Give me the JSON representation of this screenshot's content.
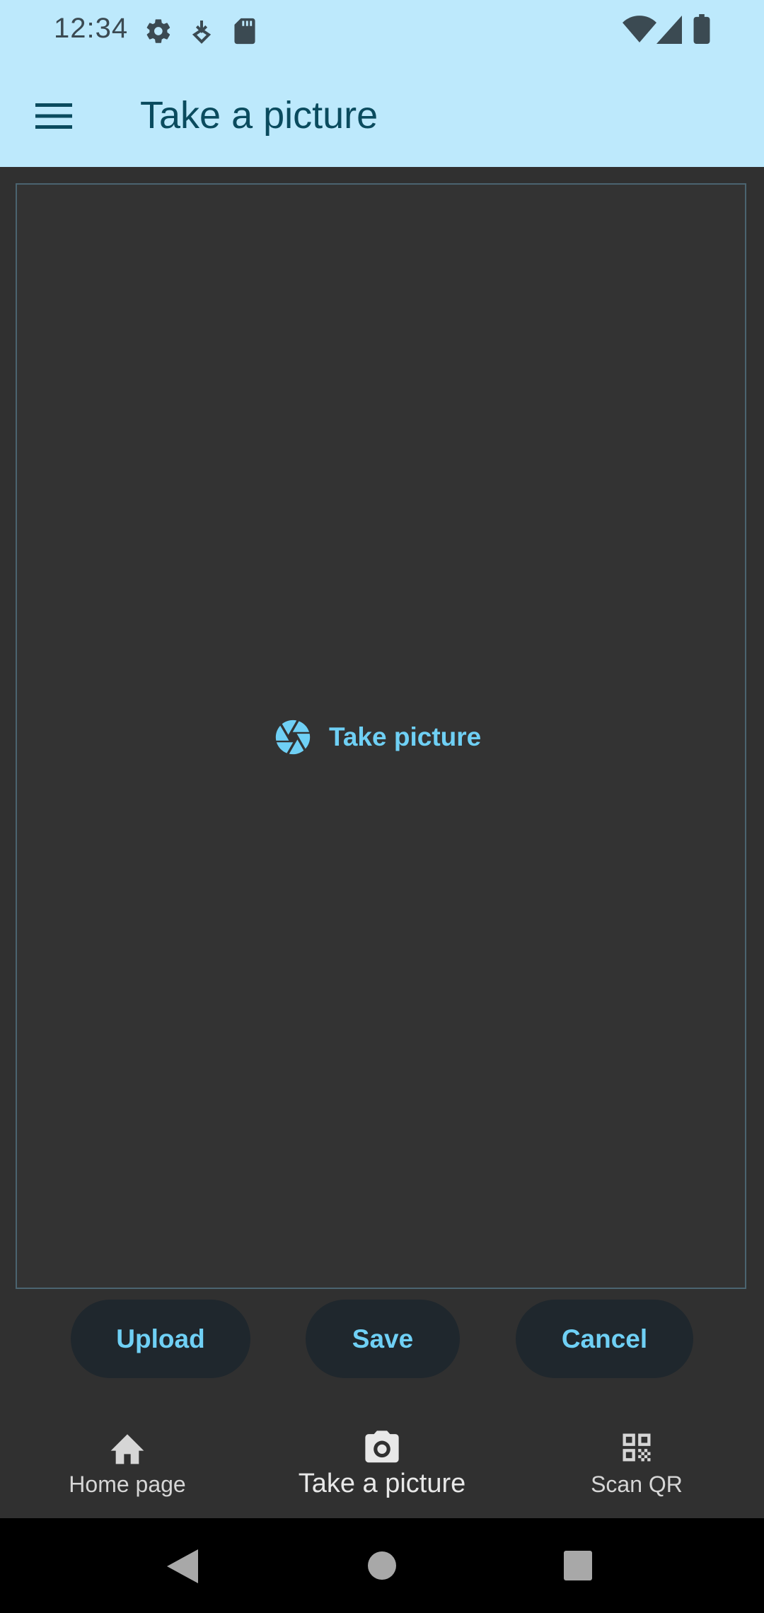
{
  "status_bar": {
    "time": "12:34",
    "left_icons": [
      "gear-icon",
      "download-icon",
      "sd-card-icon"
    ],
    "right_icons": [
      "wifi-icon",
      "signal-icon",
      "battery-icon"
    ]
  },
  "app_bar": {
    "title": "Take a picture",
    "menu_icon": "hamburger-menu-icon"
  },
  "viewer": {
    "take_picture_label": "Take picture",
    "take_picture_icon": "camera-shutter-icon"
  },
  "actions": {
    "upload_label": "Upload",
    "save_label": "Save",
    "cancel_label": "Cancel"
  },
  "bottom_nav": {
    "items": [
      {
        "label": "Home page",
        "icon": "home-icon"
      },
      {
        "label": "Take a picture",
        "icon": "camera-icon",
        "active": true
      },
      {
        "label": "Scan QR",
        "icon": "qr-code-icon"
      }
    ]
  },
  "system_nav": {
    "icons": [
      "back-icon",
      "home-circle-icon",
      "recents-icon"
    ]
  },
  "colors": {
    "app_bar_bg": "#BDE9FC",
    "accent": "#6FD0F5",
    "surface": "#333333",
    "button_bg": "#1F272D"
  }
}
